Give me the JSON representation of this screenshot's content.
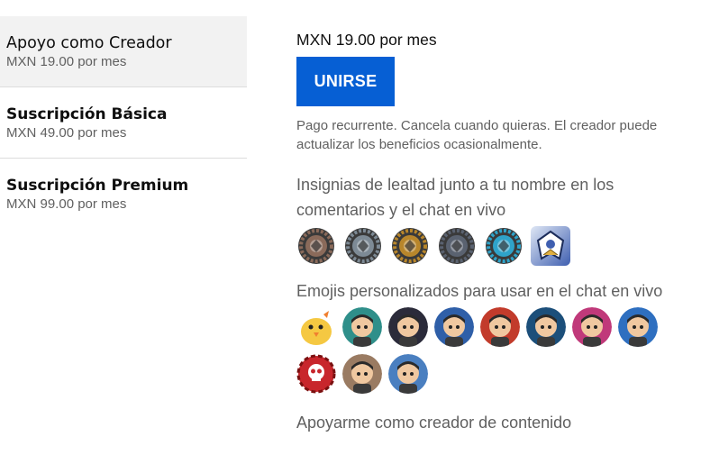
{
  "tiers": [
    {
      "name": "Apoyo como Creador",
      "price": "MXN 19.00 por mes"
    },
    {
      "name": "Suscripción Básica",
      "price": "MXN 49.00 por mes"
    },
    {
      "name": "Suscripción Premium",
      "price": "MXN 99.00 por mes"
    }
  ],
  "detail": {
    "price": "MXN 19.00 por mes",
    "join_label": "UNIRSE",
    "note": "Pago recurrente. Cancela cuando quieras. El creador puede actualizar los beneficios ocasionalmente.",
    "perk_badges_title": "Insignias de lealtad junto a tu nombre en los comentarios y el chat en vivo",
    "perk_emojis_title": "Emojis personalizados para usar en el chat en vivo",
    "perk_support_title": "Apoyarme como creador de contenido"
  },
  "badges": [
    {
      "icon": "bronze-badge-icon",
      "color": "#8a6a5a"
    },
    {
      "icon": "silver-badge-icon",
      "color": "#7d8a95"
    },
    {
      "icon": "gold-badge-icon",
      "color": "#b8862b"
    },
    {
      "icon": "platinum-badge-icon",
      "color": "#5a6270"
    },
    {
      "icon": "diamond-badge-icon",
      "color": "#2fa3c9"
    },
    {
      "icon": "emblem-badge-icon",
      "color": "#3f5fb0"
    }
  ],
  "emojis": [
    {
      "icon": "chick-emoji-icon",
      "color": "#f5c842"
    },
    {
      "icon": "soldier-emoji-icon",
      "color": "#2f8f8a"
    },
    {
      "icon": "gunner-emoji-icon",
      "color": "#2b2b3a"
    },
    {
      "icon": "goggles-emoji-icon",
      "color": "#2f5fa8"
    },
    {
      "icon": "red-soldier-emoji-icon",
      "color": "#c23b2b"
    },
    {
      "icon": "armor-emoji-icon",
      "color": "#1c4f7a"
    },
    {
      "icon": "fighter-emoji-icon",
      "color": "#c0397a"
    },
    {
      "icon": "blue-soldier-emoji-icon",
      "color": "#2e6fc0"
    },
    {
      "icon": "gear-skull-emoji-icon",
      "color": "#c8262c"
    },
    {
      "icon": "beast-emoji-icon",
      "color": "#9a7b62"
    },
    {
      "icon": "blonde-emoji-icon",
      "color": "#4a7fc0"
    }
  ]
}
